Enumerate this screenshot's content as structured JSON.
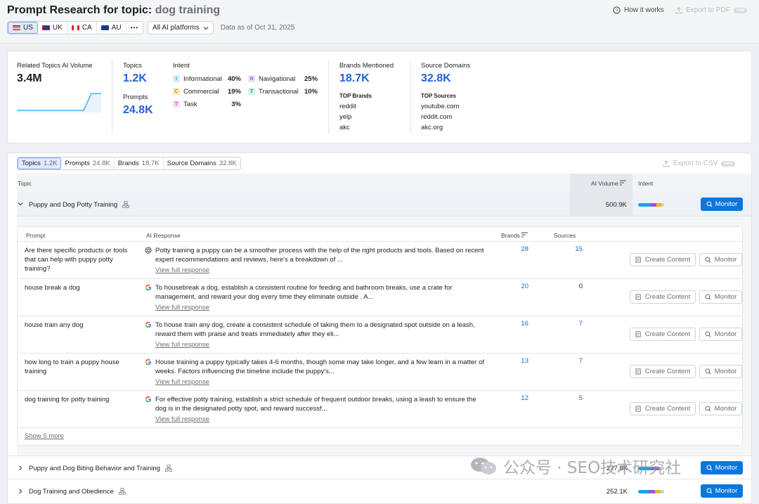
{
  "header": {
    "title": "Prompt Research for topic:",
    "topic": "dog training",
    "how_it_works": "How it works",
    "export_pdf": "Export to PDF",
    "new_badge": "new"
  },
  "databases": [
    {
      "code": "US",
      "active": true
    },
    {
      "code": "UK",
      "active": false
    },
    {
      "code": "CA",
      "active": false
    },
    {
      "code": "AU",
      "active": false
    }
  ],
  "more": "•••",
  "platform_filter": "All AI platforms",
  "data_as_of": "Data as of Oct 31, 2025",
  "summary": {
    "volume_label": "Related Topics AI Volume",
    "volume_value": "3.4M",
    "topics_label": "Topics",
    "topics_value": "1.2K",
    "prompts_label": "Prompts",
    "prompts_value": "24.8K",
    "intent_label": "Intent",
    "intents": [
      {
        "letter": "I",
        "name": "Informational",
        "pct": "40%",
        "color": "#1ba3e0",
        "bg": "#d6eefa"
      },
      {
        "letter": "N",
        "name": "Navigational",
        "pct": "25%",
        "color": "#9b59d0",
        "bg": "#ecdff6"
      },
      {
        "letter": "C",
        "name": "Commercial",
        "pct": "19%",
        "color": "#c58a06",
        "bg": "#fbe9b8"
      },
      {
        "letter": "T",
        "name": "Transactional",
        "pct": "10%",
        "color": "#11a37a",
        "bg": "#d3f1e6"
      },
      {
        "letter": "T",
        "name": "Task",
        "pct": "3%",
        "color": "#c94ec0",
        "bg": "#f6dcf3"
      }
    ],
    "brands_label": "Brands Mentioned",
    "brands_value": "18.7K",
    "top_brands_label": "TOP Brands",
    "top_brands": [
      "reddit",
      "yelp",
      "akc"
    ],
    "sources_label": "Source Domains",
    "sources_value": "32.8K",
    "top_sources_label": "TOP Sources",
    "top_sources": [
      "youtube.com",
      "reddit.com",
      "akc.org"
    ]
  },
  "table_tabs": [
    {
      "label": "Topics",
      "count": "1.2K",
      "active": true
    },
    {
      "label": "Prompts",
      "count": "24.8K",
      "active": false
    },
    {
      "label": "Brands",
      "count": "18.7K",
      "active": false
    },
    {
      "label": "Source Domains",
      "count": "32.8K",
      "active": false
    }
  ],
  "export_csv": "Export to CSV",
  "columns": {
    "topic": "Topic",
    "ai_volume": "AI Volume",
    "intent": "Intent"
  },
  "topics": [
    {
      "name": "Puppy and Dog Potty Training",
      "volume": "500.9K",
      "monitor": "Monitor",
      "expanded": true
    },
    {
      "name": "Puppy and Dog Biting Behavior and Training",
      "volume": "277.8K",
      "monitor": "Monitor",
      "expanded": false
    },
    {
      "name": "Dog Training and Obedience",
      "volume": "252.1K",
      "monitor": "Monitor",
      "expanded": false
    }
  ],
  "sub_columns": {
    "prompt": "Prompt",
    "response": "AI Response",
    "brands": "Brands",
    "sources": "Sources"
  },
  "prompts": [
    {
      "prompt": "Are there specific products or tools that can help with puppy potty training?",
      "engine": "chatgpt",
      "response": "Potty training a puppy can be a smoother process with the help of the right products and tools. Based on recent expert recommendations and reviews, here's a breakdown of ...",
      "brands": "28",
      "sources": "15",
      "sources_link": true
    },
    {
      "prompt": "house break a dog",
      "engine": "google",
      "response": "To housebreak a dog, establish a consistent routine for feeding and bathroom breaks, use a crate for management, and reward your dog every time they eliminate outside . A...",
      "brands": "20",
      "sources": "0",
      "sources_link": false
    },
    {
      "prompt": "house train any dog",
      "engine": "google",
      "response": "To house train any dog, create a consistent schedule of taking them to a designated spot outside on a leash, reward them with praise and treats immediately after they eli...",
      "brands": "16",
      "sources": "7",
      "sources_link": true
    },
    {
      "prompt": "how long to train a puppy house training",
      "engine": "google",
      "response": "House training a puppy typically takes 4-6 months, though some may take longer, and a few learn in a matter of weeks. Factors influencing the timeline include the puppy's...",
      "brands": "13",
      "sources": "7",
      "sources_link": true
    },
    {
      "prompt": "dog training for potty training",
      "engine": "google",
      "response": "For effective potty training, establish a strict schedule of frequent outdoor breaks, using a leash to ensure the dog is in the designated potty spot, and reward successf...",
      "brands": "12",
      "sources": "5",
      "sources_link": true
    }
  ],
  "view_full": "View full response",
  "create_content": "Create Content",
  "monitor": "Monitor",
  "show_more": "Show 5 more",
  "watermark": "公众号 · SEO技术研究社"
}
